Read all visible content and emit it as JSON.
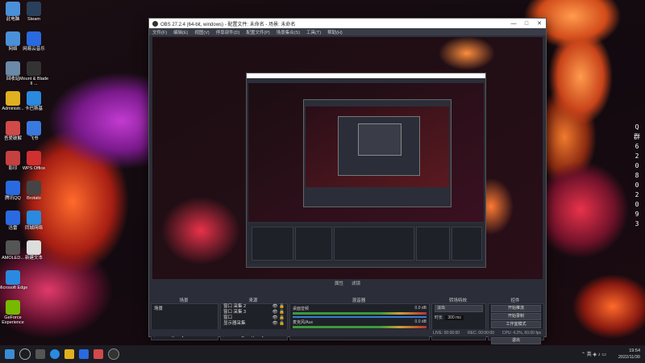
{
  "desktop": {
    "icons_left": [
      {
        "label": "此电脑",
        "color": "#4a90d9"
      },
      {
        "label": "网络",
        "color": "#4a90d9"
      },
      {
        "label": "回收站",
        "color": "#6a8aa8"
      },
      {
        "label": "Administr...",
        "color": "#e0b020"
      },
      {
        "label": "吾爱破解",
        "color": "#d04a4a"
      },
      {
        "label": "影印",
        "color": "#c74040"
      },
      {
        "label": "腾讯QQ",
        "color": "#2a6ae0"
      },
      {
        "label": "迅雷",
        "color": "#2a6ae0"
      },
      {
        "label": "AMOLED...",
        "color": "#555"
      },
      {
        "label": "Microsoft Edge",
        "color": "#2a8ae0"
      },
      {
        "label": "GeForce Experience",
        "color": "#76b900"
      }
    ],
    "icons_col2": [
      {
        "label": "Steam",
        "color": "#2a3f5a"
      },
      {
        "label": "网易云音乐",
        "color": "#2a6ae0"
      },
      {
        "label": "Mount & Blade II ...",
        "color": "#333"
      },
      {
        "label": "卡巴斯基",
        "color": "#2a8ae0"
      },
      {
        "label": "飞书",
        "color": "#3a7ae0"
      },
      {
        "label": "WPS Office",
        "color": "#d03030"
      },
      {
        "label": "Brotato",
        "color": "#444"
      },
      {
        "label": "同城网络",
        "color": "#2a8ae0"
      },
      {
        "label": "新建文本",
        "color": "#ddd"
      }
    ],
    "right_text": [
      "Q",
      "群",
      "6",
      "2",
      "0",
      "8",
      "0",
      "2",
      "0",
      "9",
      "3"
    ],
    "right_text_2": [
      "Q",
      "群",
      "6",
      "2",
      "0",
      "8",
      "0",
      "2",
      "0",
      "9",
      "3"
    ]
  },
  "obs": {
    "title": "OBS 27.2.4 (64-bit, windows) - 配置文件: 未命名 - 场景: 未命名",
    "menu": [
      "文件(F)",
      "编辑(E)",
      "视图(V)",
      "停靠部件(D)",
      "配置文件(P)",
      "场景集合(S)",
      "工具(T)",
      "帮助(H)"
    ],
    "preview_toolbar": [
      "属性",
      "滤镜"
    ],
    "docks": {
      "scenes_title": "场景",
      "sources_title": "来源",
      "mixer_title": "混音器",
      "transitions_title": "转场特效",
      "controls_title": "控件"
    },
    "scenes": [
      "场景"
    ],
    "sources": [
      "窗口 采集 2",
      "窗口 采集 3",
      "窗口",
      "显示器采集"
    ],
    "mixer": [
      {
        "name": "桌面音频",
        "db": "0.0 dB"
      },
      {
        "name": "麦克风/Aux",
        "db": "0.0 dB"
      }
    ],
    "transition": {
      "name": "淡出",
      "duration_label": "时长",
      "duration": "300 ms"
    },
    "controls": [
      "开始推流",
      "开始录制",
      "工作室模式",
      "设置",
      "退出"
    ],
    "status": [
      "LIVE: 00:00:00",
      "REC: 00:00:00",
      "CPU: 4.2%, 60.00 fps"
    ]
  },
  "taskbar": {
    "time": "19:54",
    "date": "2022/11/30",
    "lang": "英"
  }
}
